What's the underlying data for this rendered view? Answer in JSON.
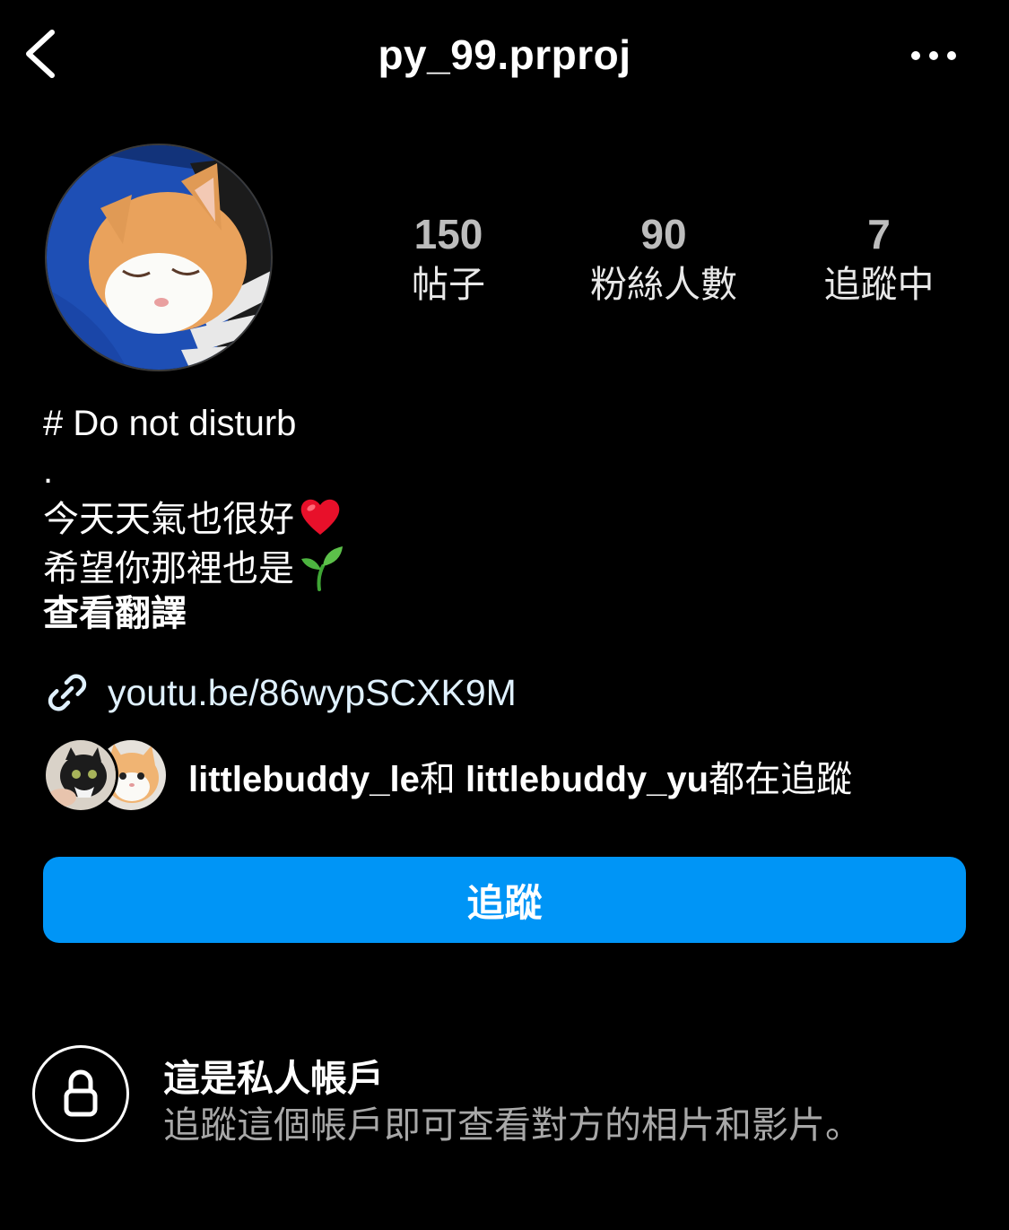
{
  "header": {
    "username": "py_99.prproj",
    "back_icon": "chevron-left-icon",
    "more_icon": "more-horizontal-icon"
  },
  "profile": {
    "avatar": "cat-profile-photo"
  },
  "stats": {
    "posts": {
      "value": "150",
      "label": "帖子"
    },
    "followers": {
      "value": "90",
      "label": "粉絲人數"
    },
    "following": {
      "value": "7",
      "label": "追蹤中"
    }
  },
  "bio": {
    "line1": "# Do not disturb",
    "line2": ".",
    "line3": "今天天氣也很好",
    "line3_emoji": "red-heart-emoji",
    "line4": "希望你那裡也是",
    "line4_emoji": "seedling-emoji",
    "see_translation": "查看翻譯"
  },
  "link": {
    "icon": "link-icon",
    "text": "youtu.be/86wypSCXK9M"
  },
  "followed_by": {
    "user1": "littlebuddy_le",
    "connector": "和",
    "user2": "littlebuddy_yu",
    "suffix": "都在追蹤"
  },
  "follow_button": {
    "label": "追蹤",
    "color": "#0095f6"
  },
  "private_notice": {
    "icon": "lock-icon",
    "title": "這是私人帳戶",
    "subtitle": "追蹤這個帳戶即可查看對方的相片和影片。"
  }
}
